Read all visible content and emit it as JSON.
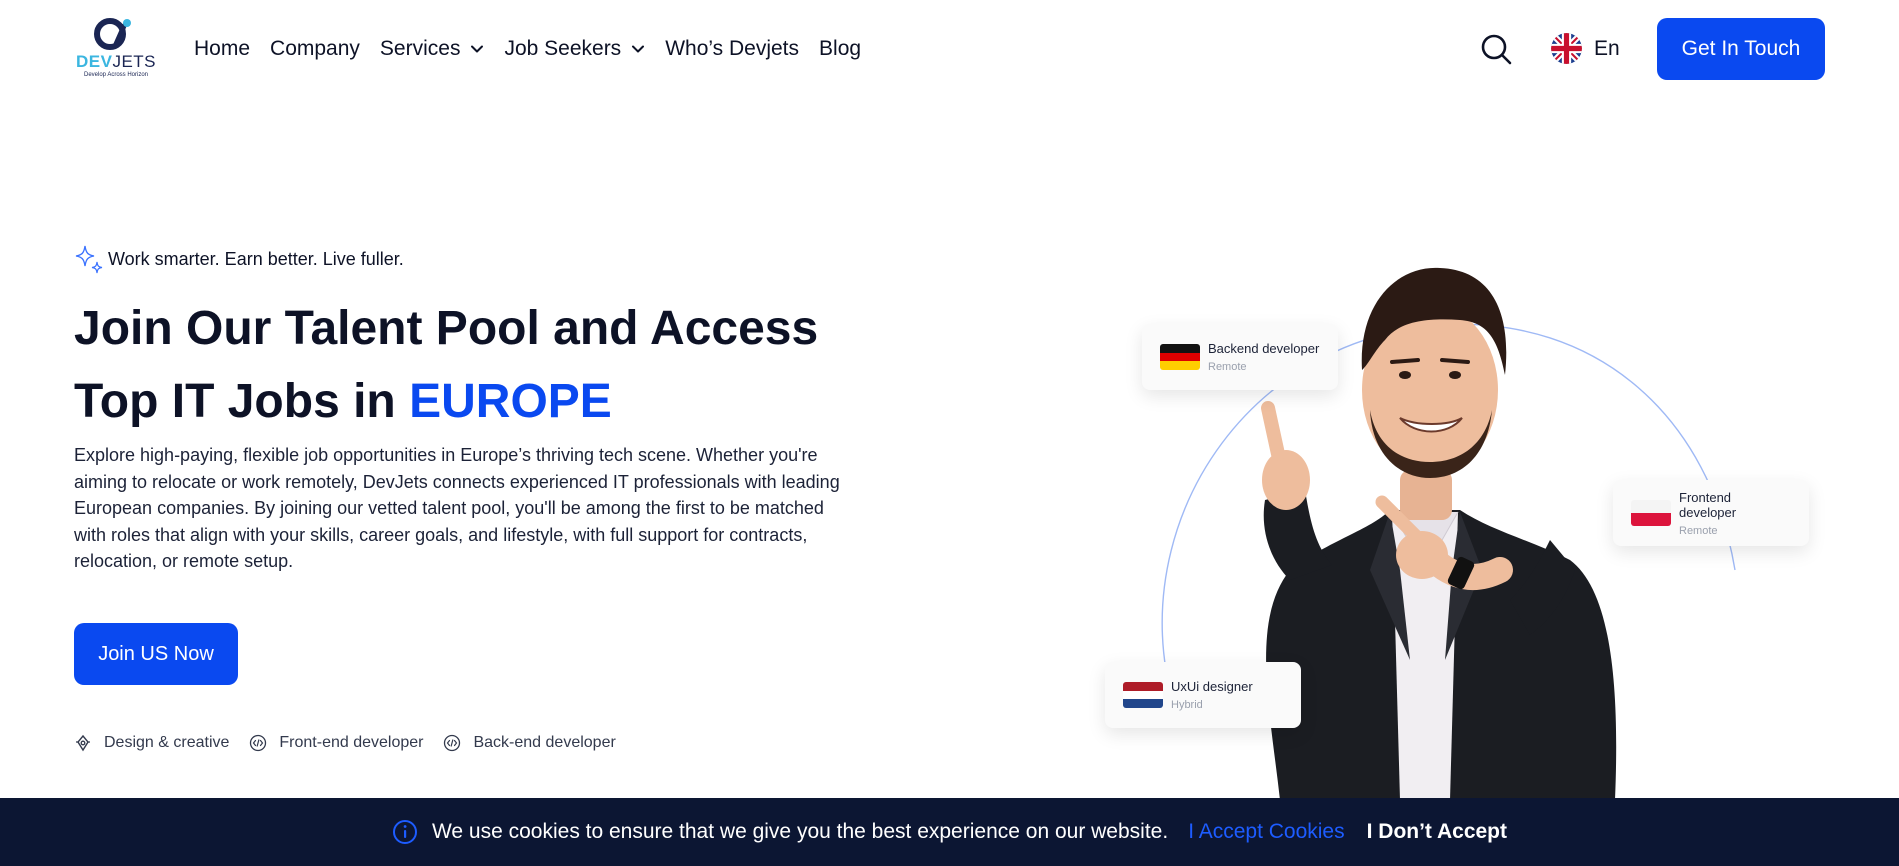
{
  "brand": {
    "logo_word_dev": "DEV",
    "logo_word_jets": "JETS",
    "logo_tagline": "Develop Across Horizon",
    "accent_color": "#0a49f0",
    "dark_color": "#0c1633"
  },
  "nav": {
    "items": [
      {
        "label": "Home",
        "icon": ""
      },
      {
        "label": "Company",
        "icon": ""
      },
      {
        "label": "Services",
        "icon": "chevron-down-icon"
      },
      {
        "label": "Job Seekers",
        "icon": "chevron-down-icon"
      },
      {
        "label": "Who’s Devjets",
        "icon": ""
      },
      {
        "label": "Blog",
        "icon": ""
      }
    ],
    "search_icon": "search-icon",
    "language": "En",
    "language_flag": "uk-flag-icon",
    "cta_label": "Get In Touch"
  },
  "hero": {
    "tagline": "Work smarter. Earn better. Live fuller.",
    "title_line1": "Join Our Talent Pool and Access",
    "title_line2_prefix": "Top IT Jobs in ",
    "title_accent": "EUROPE",
    "description": "Explore high-paying, flexible job opportunities in Europe’s thriving tech scene. Whether you're aiming to relocate or work remotely, DevJets connects experienced IT professionals with leading European companies. By joining our vetted talent pool, you'll be among the first to be matched with roles that align with your skills, career goals, and lifestyle, with full support for contracts, relocation, or remote setup.",
    "cta_label": "Join US Now",
    "categories": [
      {
        "label": "Design & creative",
        "icon": "design-pen-icon"
      },
      {
        "label": "Front-end developer",
        "icon": "code-icon"
      },
      {
        "label": "Back-end developer",
        "icon": "code-icon"
      }
    ]
  },
  "job_cards": [
    {
      "title": "Backend developer",
      "mode": "Remote",
      "flag": "germany-flag-icon"
    },
    {
      "title": "Frontend developer",
      "mode": "Remote",
      "flag": "poland-flag-icon"
    },
    {
      "title": "UxUi designer",
      "mode": "Hybrid",
      "flag": "netherlands-flag-icon"
    }
  ],
  "cookie_bar": {
    "message": "We use cookies to ensure that we give you the best experience on our website.",
    "accept_label": "I Accept Cookies",
    "reject_label": "I Don’t Accept"
  }
}
